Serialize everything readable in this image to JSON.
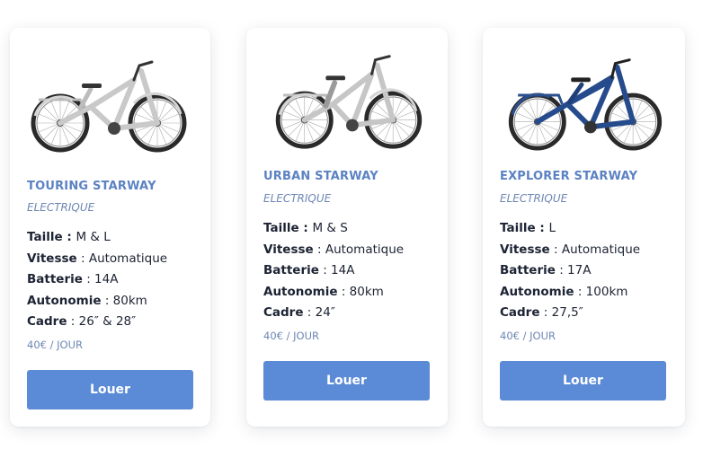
{
  "colors": {
    "accent": "#5b8bd6",
    "title": "#5b82c2",
    "subtitle": "#6d87b4",
    "price": "#6d87b4",
    "text": "#1c2333"
  },
  "products": [
    {
      "title": "TOURING STARWAY",
      "type": "ELECTRIQUE",
      "image_icon": "silver-step-through-ebike-image",
      "specs": [
        {
          "label": "Taille",
          "value": "M & L"
        },
        {
          "label": "Vitesse",
          "value": "Automatique"
        },
        {
          "label": "Batterie",
          "value": "14A"
        },
        {
          "label": "Autonomie",
          "value": "80km"
        },
        {
          "label": "Cadre",
          "value": "26″ & 28″"
        }
      ],
      "price": "40€ / JOUR",
      "button_label": "Louer"
    },
    {
      "title": "URBAN STARWAY",
      "type": "ELECTRIQUE",
      "image_icon": "silver-city-ebike-image",
      "specs": [
        {
          "label": "Taille",
          "value": "M & S"
        },
        {
          "label": "Vitesse",
          "value": "Automatique"
        },
        {
          "label": "Batterie",
          "value": "14A"
        },
        {
          "label": "Autonomie",
          "value": "80km"
        },
        {
          "label": "Cadre",
          "value": "24″"
        }
      ],
      "price": "40€ / JOUR",
      "button_label": "Louer"
    },
    {
      "title": "EXPLORER STARWAY",
      "type": "ELECTRIQUE",
      "image_icon": "blue-trekking-ebike-image",
      "specs": [
        {
          "label": "Taille",
          "value": "L"
        },
        {
          "label": "Vitesse",
          "value": "Automatique"
        },
        {
          "label": "Batterie",
          "value": "17A"
        },
        {
          "label": "Autonomie",
          "value": "100km"
        },
        {
          "label": "Cadre",
          "value": "27,5″"
        }
      ],
      "price": "40€ / JOUR",
      "button_label": "Louer"
    }
  ]
}
